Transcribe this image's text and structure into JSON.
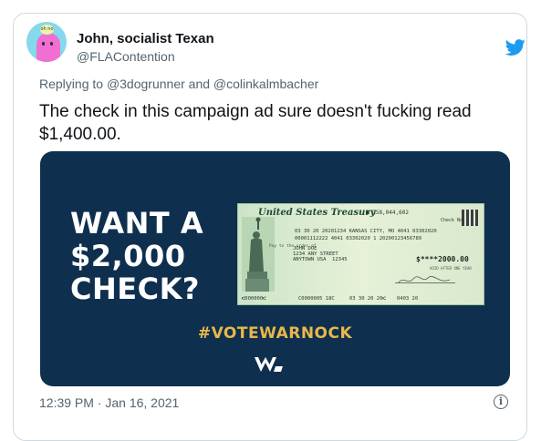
{
  "author": {
    "display_name": "John, socialist Texan",
    "handle": "@FLAContention",
    "avatar_bubble_text": "oh no"
  },
  "reply": {
    "prefix": "Replying to ",
    "mention_1": "@3dogrunner",
    "conjunction": " and ",
    "mention_2": "@colinkalmbacher"
  },
  "tweet": {
    "text": "The check in this campaign ad sure doesn't fucking read $1,400.00."
  },
  "ad": {
    "headline_line_1": "WANT A",
    "headline_line_2": "$2,000",
    "headline_line_3": "CHECK?",
    "hashtag": "#VOTEWARNOCK",
    "check": {
      "title": "United States Treasury",
      "serial": "■ 158,044,602",
      "check_no_label": "Check No.",
      "line_1": "03 30 20 20201234  KANSAS CITY, MO    4041 03302020",
      "line_2": "00001112222   4041 03302020 1   20200123456789",
      "pay_label": "Pay to the order of",
      "payee": "JOHN DOE\n1234 ANY STREET\nANYTOWN USA  12345",
      "amount": "$****2000.00",
      "void_note": "VOID AFTER ONE YEAR",
      "micr_1": "⑆000000⑆",
      "micr_2": "C0000005 18C",
      "micr_3": "03 30 20 20⑆",
      "micr_4": "0403 20"
    }
  },
  "timestamp": "12:39 PM · Jan 16, 2021",
  "colors": {
    "brand_blue": "#1d9bf0",
    "ad_navy": "#0f2f4f",
    "hashtag_gold": "#e7b84a",
    "muted_text": "#536471"
  }
}
